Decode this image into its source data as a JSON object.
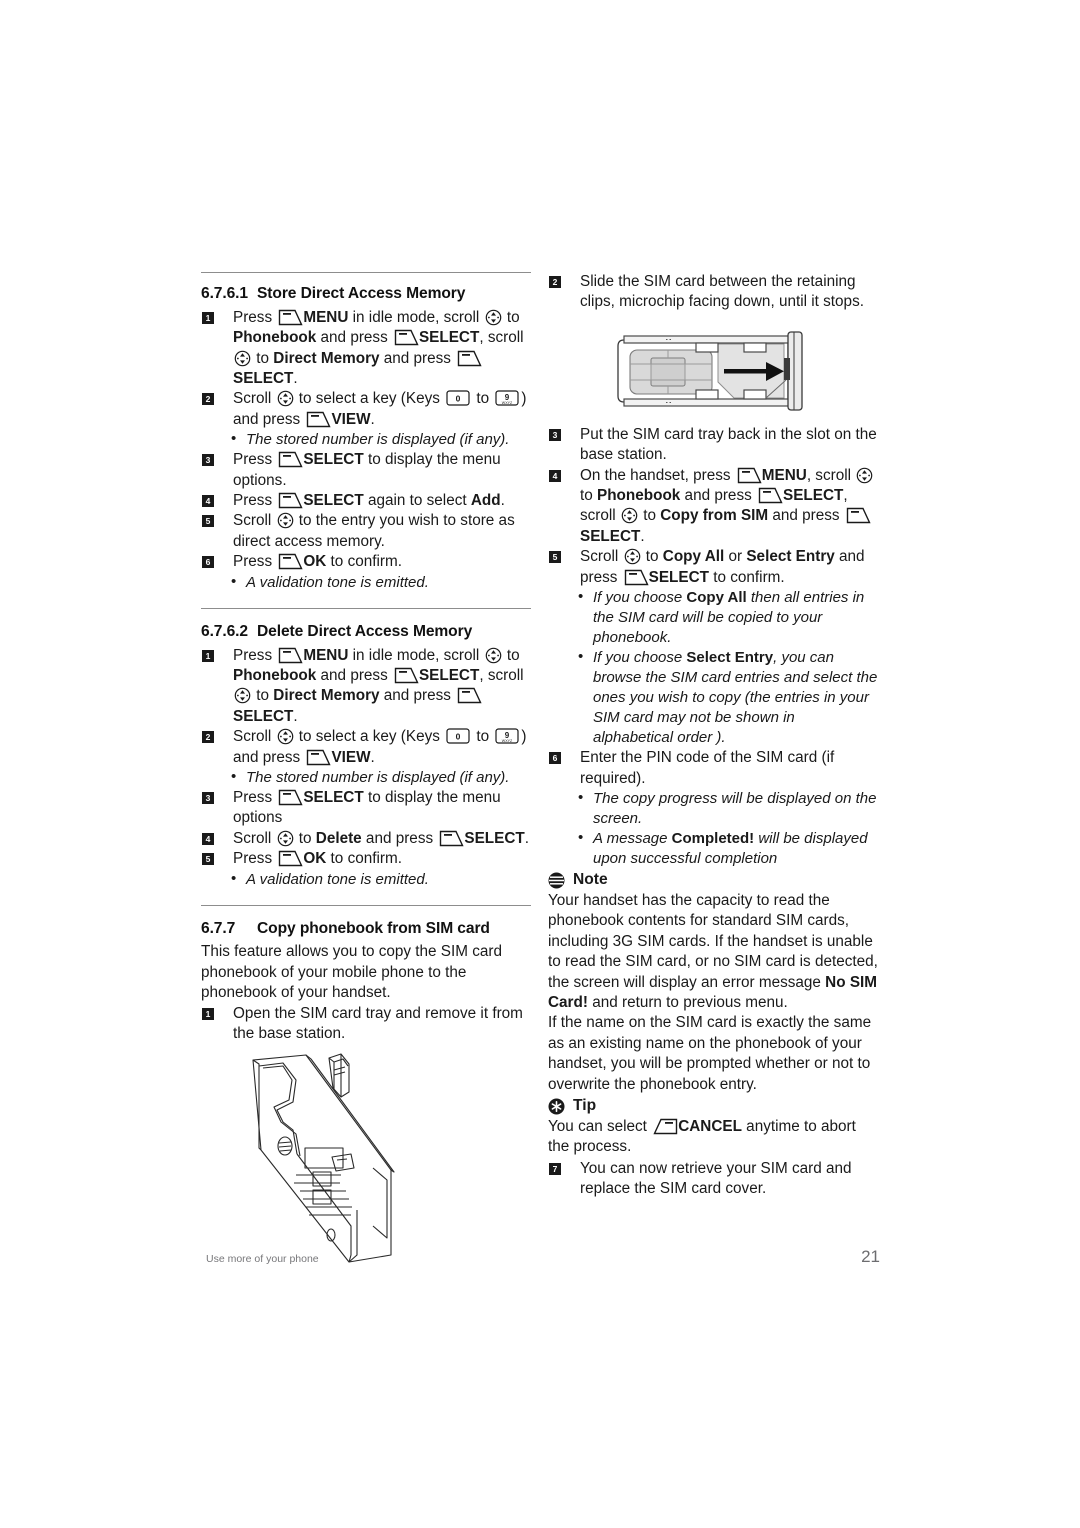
{
  "document": {
    "footer_label": "Use more of your phone",
    "page_number": "21"
  },
  "icons": {
    "softkey": "softkey-icon",
    "softkey_left": "softkey-left-icon",
    "scroll": "scroll-updown-icon",
    "key0": "0",
    "key9": "9",
    "note": "note-icon",
    "tip": "tip-icon"
  },
  "left_column": {
    "section_1": {
      "number": "6.7.6.1",
      "title": "Store Direct Access Memory",
      "steps": [
        {
          "badge": "1",
          "parts": [
            {
              "t": "text",
              "v": "Press "
            },
            {
              "t": "softkey"
            },
            {
              "t": "bold",
              "v": "MENU"
            },
            {
              "t": "text",
              "v": " in idle mode, scroll "
            },
            {
              "t": "scroll"
            },
            {
              "t": "text",
              "v": " to "
            },
            {
              "t": "bold",
              "v": "Phonebook"
            },
            {
              "t": "text",
              "v": " and press "
            },
            {
              "t": "softkey"
            },
            {
              "t": "bold",
              "v": "SELECT"
            },
            {
              "t": "text",
              "v": ", scroll "
            },
            {
              "t": "scroll"
            },
            {
              "t": "text",
              "v": " to "
            },
            {
              "t": "bold",
              "v": "Direct Memory"
            },
            {
              "t": "text",
              "v": " and press "
            },
            {
              "t": "softkey"
            },
            {
              "t": "bold",
              "v": "SELECT"
            },
            {
              "t": "text",
              "v": "."
            }
          ]
        },
        {
          "badge": "2",
          "parts": [
            {
              "t": "text",
              "v": "Scroll "
            },
            {
              "t": "scroll"
            },
            {
              "t": "text",
              "v": " to select a key (Keys "
            },
            {
              "t": "numkey",
              "v": "0"
            },
            {
              "t": "text",
              "v": " to "
            },
            {
              "t": "numkey",
              "v": "9"
            },
            {
              "t": "text",
              "v": ") and press "
            },
            {
              "t": "softkey"
            },
            {
              "t": "bold",
              "v": "VIEW"
            },
            {
              "t": "text",
              "v": "."
            }
          ]
        }
      ],
      "bullet_1": "The stored number is displayed (if any).",
      "steps_b": [
        {
          "badge": "3",
          "parts": [
            {
              "t": "text",
              "v": "Press "
            },
            {
              "t": "softkey"
            },
            {
              "t": "bold",
              "v": "SELECT"
            },
            {
              "t": "text",
              "v": " to display the menu options."
            }
          ]
        },
        {
          "badge": "4",
          "parts": [
            {
              "t": "text",
              "v": "Press "
            },
            {
              "t": "softkey"
            },
            {
              "t": "bold",
              "v": "SELECT"
            },
            {
              "t": "text",
              "v": " again to select "
            },
            {
              "t": "bold",
              "v": "Add"
            },
            {
              "t": "text",
              "v": "."
            }
          ]
        },
        {
          "badge": "5",
          "parts": [
            {
              "t": "text",
              "v": "Scroll "
            },
            {
              "t": "scroll"
            },
            {
              "t": "text",
              "v": " to the entry you wish to store as direct access memory."
            }
          ]
        },
        {
          "badge": "6",
          "parts": [
            {
              "t": "text",
              "v": "Press "
            },
            {
              "t": "softkey"
            },
            {
              "t": "bold",
              "v": "OK"
            },
            {
              "t": "text",
              "v": " to confirm."
            }
          ]
        }
      ],
      "bullet_2": "A validation tone is emitted."
    },
    "section_2": {
      "number": "6.7.6.2",
      "title": "Delete Direct Access Memory",
      "steps": [
        {
          "badge": "1",
          "parts": [
            {
              "t": "text",
              "v": "Press "
            },
            {
              "t": "softkey"
            },
            {
              "t": "bold",
              "v": "MENU"
            },
            {
              "t": "text",
              "v": " in idle mode, scroll "
            },
            {
              "t": "scroll"
            },
            {
              "t": "text",
              "v": " to "
            },
            {
              "t": "bold",
              "v": "Phonebook"
            },
            {
              "t": "text",
              "v": " and press "
            },
            {
              "t": "softkey"
            },
            {
              "t": "bold",
              "v": "SELECT"
            },
            {
              "t": "text",
              "v": ", scroll "
            },
            {
              "t": "scroll"
            },
            {
              "t": "text",
              "v": " to "
            },
            {
              "t": "bold",
              "v": "Direct Memory"
            },
            {
              "t": "text",
              "v": " and press "
            },
            {
              "t": "softkey"
            },
            {
              "t": "bold",
              "v": "SELECT"
            },
            {
              "t": "text",
              "v": "."
            }
          ]
        },
        {
          "badge": "2",
          "parts": [
            {
              "t": "text",
              "v": "Scroll "
            },
            {
              "t": "scroll"
            },
            {
              "t": "text",
              "v": " to select a key (Keys "
            },
            {
              "t": "numkey",
              "v": "0"
            },
            {
              "t": "text",
              "v": " to "
            },
            {
              "t": "numkey",
              "v": "9"
            },
            {
              "t": "text",
              "v": ") and press "
            },
            {
              "t": "softkey"
            },
            {
              "t": "bold",
              "v": "VIEW"
            },
            {
              "t": "text",
              "v": "."
            }
          ]
        }
      ],
      "bullet_1": "The stored number is displayed (if any).",
      "steps_b": [
        {
          "badge": "3",
          "parts": [
            {
              "t": "text",
              "v": "Press "
            },
            {
              "t": "softkey"
            },
            {
              "t": "bold",
              "v": "SELECT"
            },
            {
              "t": "text",
              "v": " to display the menu options"
            }
          ]
        },
        {
          "badge": "4",
          "parts": [
            {
              "t": "text",
              "v": "Scroll "
            },
            {
              "t": "scroll"
            },
            {
              "t": "text",
              "v": " to "
            },
            {
              "t": "bold",
              "v": "Delete"
            },
            {
              "t": "text",
              "v": " and press "
            },
            {
              "t": "softkey"
            },
            {
              "t": "bold",
              "v": "SELECT"
            },
            {
              "t": "text",
              "v": "."
            }
          ]
        },
        {
          "badge": "5",
          "parts": [
            {
              "t": "text",
              "v": "Press "
            },
            {
              "t": "softkey"
            },
            {
              "t": "bold",
              "v": "OK"
            },
            {
              "t": "text",
              "v": " to confirm."
            }
          ]
        }
      ],
      "bullet_2": "A validation tone is emitted."
    },
    "section_3": {
      "number": "6.7.7",
      "title": "Copy phonebook from SIM card",
      "intro": "This feature allows you to copy the SIM card phonebook of your mobile phone to the phonebook of your handset.",
      "step_1_badge": "1",
      "step_1_text": "Open the SIM card tray and remove it from the base station."
    }
  },
  "right_column": {
    "step_2": {
      "badge": "2",
      "text": "Slide the SIM card between the retaining clips, microchip facing down, until it stops."
    },
    "figure_sim_tray": "sim-card-tray-diagram",
    "step_3": {
      "badge": "3",
      "text": "Put the SIM card tray back in the slot on the base station."
    },
    "step_4": {
      "badge": "4",
      "parts": [
        {
          "t": "text",
          "v": "On the handset, press "
        },
        {
          "t": "softkey"
        },
        {
          "t": "bold",
          "v": "MENU"
        },
        {
          "t": "text",
          "v": ", scroll "
        },
        {
          "t": "scroll"
        },
        {
          "t": "text",
          "v": " to "
        },
        {
          "t": "bold",
          "v": "Phonebook"
        },
        {
          "t": "text",
          "v": " and press "
        },
        {
          "t": "softkey"
        },
        {
          "t": "bold",
          "v": "SELECT"
        },
        {
          "t": "text",
          "v": ", scroll "
        },
        {
          "t": "scroll"
        },
        {
          "t": "text",
          "v": " to "
        },
        {
          "t": "bold",
          "v": "Copy from SIM"
        },
        {
          "t": "text",
          "v": " and press "
        },
        {
          "t": "softkey"
        },
        {
          "t": "bold",
          "v": "SELECT"
        },
        {
          "t": "text",
          "v": "."
        }
      ]
    },
    "step_5": {
      "badge": "5",
      "parts": [
        {
          "t": "text",
          "v": "Scroll "
        },
        {
          "t": "scroll"
        },
        {
          "t": "text",
          "v": " to "
        },
        {
          "t": "bold",
          "v": "Copy All"
        },
        {
          "t": "text",
          "v": " or "
        },
        {
          "t": "bold",
          "v": "Select Entry"
        },
        {
          "t": "text",
          "v": " and press "
        },
        {
          "t": "softkey"
        },
        {
          "t": "bold",
          "v": "SELECT"
        },
        {
          "t": "text",
          "v": " to confirm."
        }
      ]
    },
    "bullet_copy_all_a": "If you choose ",
    "bullet_copy_all_b": "Copy All",
    "bullet_copy_all_c": " then all entries in the SIM card will be copied to your phonebook.",
    "bullet_select_entry_a": "If you choose ",
    "bullet_select_entry_b": "Select Entry",
    "bullet_select_entry_c": ", you can browse the SIM card entries and select the ones you wish to copy (the entries in your SIM card may not be shown in alphabetical order ).",
    "step_6": {
      "badge": "6",
      "text": "Enter the PIN code of the SIM card (if required)."
    },
    "bullet_progress": "The copy progress will be displayed on the screen.",
    "bullet_completed_a": "A message ",
    "bullet_completed_b": "Completed!",
    "bullet_completed_c": " will be displayed upon successful completion",
    "note": {
      "title": "Note",
      "para_1_a": "Your handset has the capacity to read the phonebook contents for standard SIM cards, including 3G SIM cards. If the handset is unable to read the SIM card, or no SIM card is detected, the screen will display an error message ",
      "para_1_b": "No SIM Card!",
      "para_1_c": " and return to previous menu.",
      "para_2": "If the name on the SIM card is exactly the same as an existing name on the phonebook of your handset, you will be prompted whether or not to overwrite the phonebook entry."
    },
    "tip": {
      "title": "Tip",
      "text_a": "You can select ",
      "text_b": "CANCEL",
      "text_c": " anytime to abort the process."
    },
    "step_7": {
      "badge": "7",
      "text": "You can now retrieve your SIM card and replace the SIM card cover."
    }
  }
}
